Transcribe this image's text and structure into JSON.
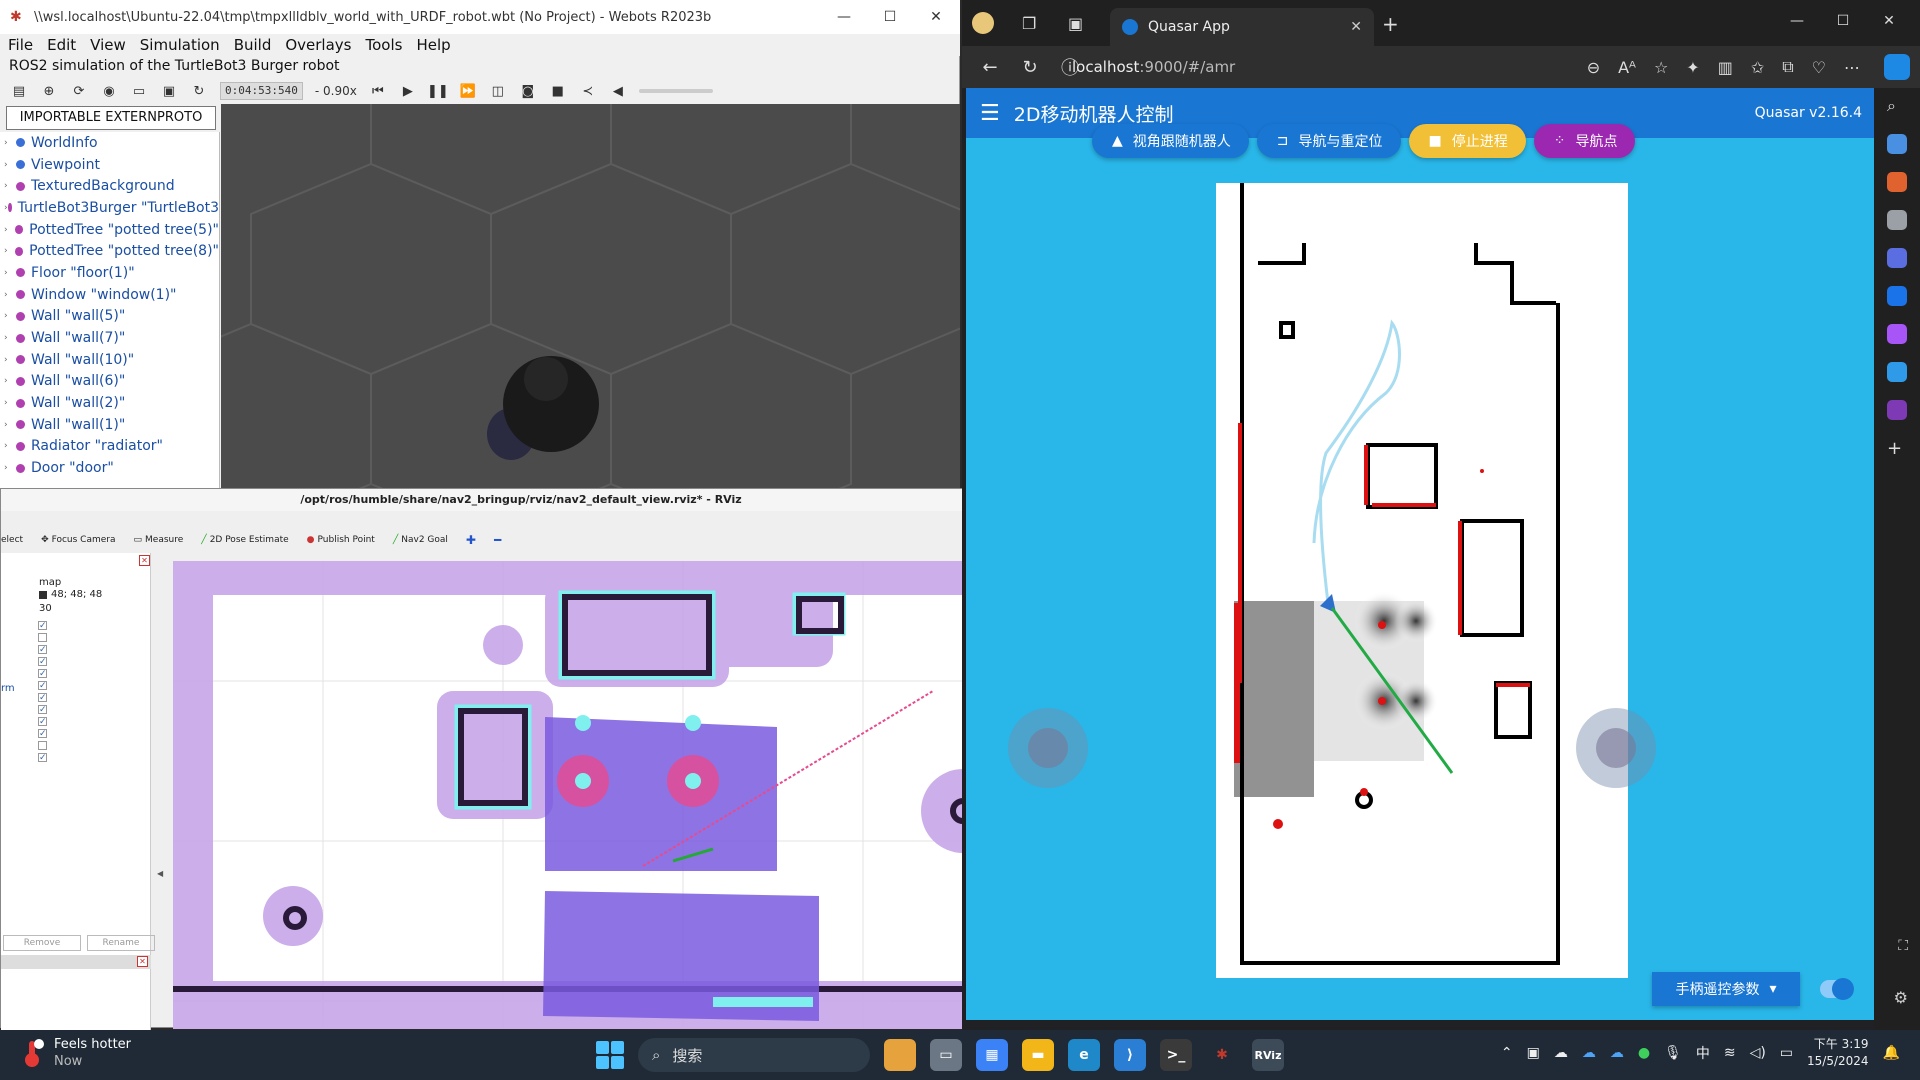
{
  "webots": {
    "title": "\\\\wsl.localhost\\Ubuntu-22.04\\tmp\\tmpxllldblv_world_with_URDF_robot.wbt (No Project) - Webots R2023b",
    "menu": [
      "File",
      "Edit",
      "View",
      "Simulation",
      "Build",
      "Overlays",
      "Tools",
      "Help"
    ],
    "subtitle": "ROS2 simulation of the TurtleBot3 Burger robot",
    "time": "0:04:53:540",
    "speed": "- 0.90x",
    "extproto_label": "IMPORTABLE EXTERNPROTO",
    "scene_tree": [
      {
        "label": "WorldInfo",
        "color": "#3a6fd8"
      },
      {
        "label": "Viewpoint",
        "color": "#3a6fd8"
      },
      {
        "label": "TexturedBackground",
        "color": "#b040b0"
      },
      {
        "label": "TurtleBot3Burger \"TurtleBot3",
        "color": "#b040b0"
      },
      {
        "label": "PottedTree \"potted tree(5)\"",
        "color": "#b040b0"
      },
      {
        "label": "PottedTree \"potted tree(8)\"",
        "color": "#b040b0"
      },
      {
        "label": "Floor \"floor(1)\"",
        "color": "#b040b0"
      },
      {
        "label": "Window \"window(1)\"",
        "color": "#b040b0"
      },
      {
        "label": "Wall \"wall(5)\"",
        "color": "#b040b0"
      },
      {
        "label": "Wall \"wall(7)\"",
        "color": "#b040b0"
      },
      {
        "label": "Wall \"wall(10)\"",
        "color": "#b040b0"
      },
      {
        "label": "Wall \"wall(6)\"",
        "color": "#b040b0"
      },
      {
        "label": "Wall \"wall(2)\"",
        "color": "#b040b0"
      },
      {
        "label": "Wall \"wall(1)\"",
        "color": "#b040b0"
      },
      {
        "label": "Radiator \"radiator\"",
        "color": "#b040b0"
      },
      {
        "label": "Door \"door\"",
        "color": "#b040b0"
      }
    ]
  },
  "rviz": {
    "title": "/opt/ros/humble/share/nav2_bringup/rviz/nav2_default_view.rviz* - RViz",
    "tools": [
      "elect",
      "Focus Camera",
      "Measure",
      "2D Pose Estimate",
      "Publish Point",
      "Nav2 Goal"
    ],
    "panel": {
      "frame": "map",
      "color": "48; 48; 48",
      "value": "30",
      "partial": "rm",
      "remove": "Remove",
      "rename": "Rename"
    }
  },
  "browser": {
    "tab_title": "Quasar App",
    "url_host": "localhost",
    "url_rest": ":9000/#/amr",
    "app_title": "2D移动机器人控制",
    "version": "Quasar v2.16.4",
    "buttons": [
      {
        "label": "视角跟随机器人",
        "color": "#1976d2",
        "icon": "navigation-icon"
      },
      {
        "label": "导航与重定位",
        "color": "#1976d2",
        "icon": "label-icon"
      },
      {
        "label": "停止进程",
        "color": "#f2c037",
        "icon": "stop-icon"
      },
      {
        "label": "导航点",
        "color": "#9c27b0",
        "icon": "waypoints-icon"
      }
    ],
    "params_label": "手柄遥控参数"
  },
  "taskbar": {
    "weather_title": "Feels hotter",
    "weather_sub": "Now",
    "search_label": "搜索",
    "ime": "中",
    "time": "下午 3:19",
    "date": "15/5/2024"
  }
}
